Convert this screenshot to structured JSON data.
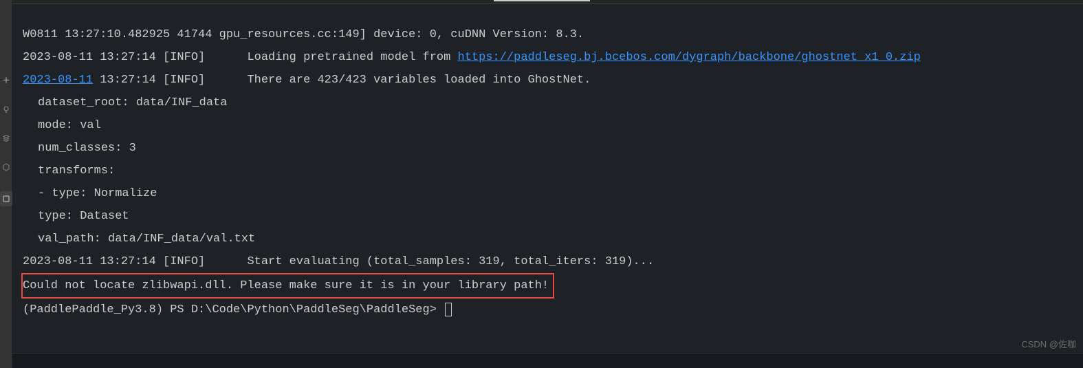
{
  "activityIcons": [
    "spark",
    "bulb",
    "stack",
    "hexagon",
    "square"
  ],
  "terminal": {
    "lines": [
      {
        "type": "plain",
        "text": "W0811 13:27:10.482925 41744 gpu_resources.cc:149] device: 0, cuDNN Version: 8.3."
      },
      {
        "type": "link1",
        "prefix": "2023-08-11 13:27:14 [INFO]\tLoading pretrained model from ",
        "link": "https://paddleseg.bj.bcebos.com/dygraph/backbone/ghostnet_x1_0.zip"
      },
      {
        "type": "link2",
        "date": "2023-08-11",
        "rest": " 13:27:14 [INFO]\tThere are 423/423 variables loaded into GhostNet."
      },
      {
        "type": "indent",
        "text": "dataset_root: data/INF_data"
      },
      {
        "type": "indent",
        "text": "mode: val"
      },
      {
        "type": "indent",
        "text": "num_classes: 3"
      },
      {
        "type": "indent",
        "text": "transforms:"
      },
      {
        "type": "indent",
        "text": "- type: Normalize"
      },
      {
        "type": "indent",
        "text": "type: Dataset"
      },
      {
        "type": "indent",
        "text": "val_path: data/INF_data/val.txt"
      },
      {
        "type": "plain",
        "text": "2023-08-11 13:27:14 [INFO]\tStart evaluating (total_samples: 319, total_iters: 319)..."
      },
      {
        "type": "error",
        "text": "Could not locate zlibwapi.dll. Please make sure it is in your library path!"
      },
      {
        "type": "prompt",
        "text": "(PaddlePaddle_Py3.8) PS D:\\Code\\Python\\PaddleSeg\\PaddleSeg> "
      }
    ]
  },
  "watermark": "CSDN @佐咖"
}
